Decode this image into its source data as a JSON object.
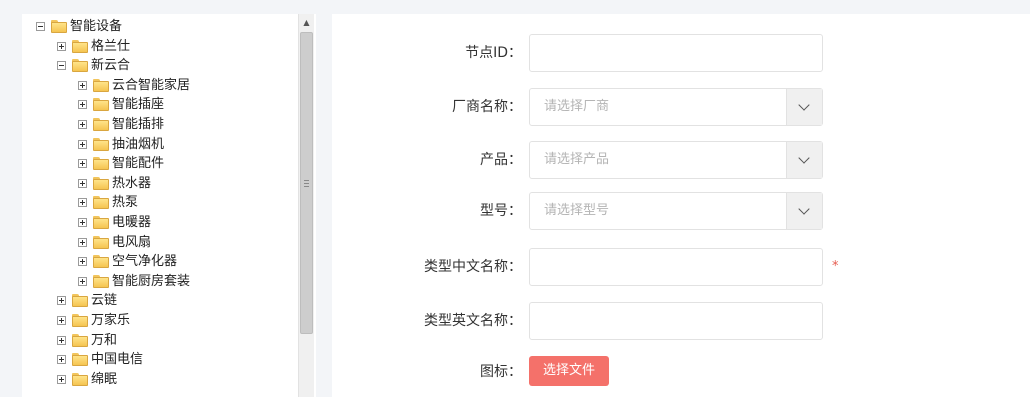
{
  "tree": {
    "nodes": [
      {
        "label": "智能设备",
        "expanded": true,
        "level": 0
      },
      {
        "label": "格兰仕",
        "expanded": false,
        "level": 1
      },
      {
        "label": "新云合",
        "expanded": true,
        "level": 1
      },
      {
        "label": "云合智能家居",
        "expanded": false,
        "level": 2
      },
      {
        "label": "智能插座",
        "expanded": false,
        "level": 2
      },
      {
        "label": "智能插排",
        "expanded": false,
        "level": 2
      },
      {
        "label": "抽油烟机",
        "expanded": false,
        "level": 2
      },
      {
        "label": "智能配件",
        "expanded": false,
        "level": 2
      },
      {
        "label": "热水器",
        "expanded": false,
        "level": 2
      },
      {
        "label": "热泵",
        "expanded": false,
        "level": 2
      },
      {
        "label": "电暖器",
        "expanded": false,
        "level": 2
      },
      {
        "label": "电风扇",
        "expanded": false,
        "level": 2
      },
      {
        "label": "空气净化器",
        "expanded": false,
        "level": 2
      },
      {
        "label": "智能厨房套装",
        "expanded": false,
        "level": 2
      },
      {
        "label": "云链",
        "expanded": false,
        "level": 1
      },
      {
        "label": "万家乐",
        "expanded": false,
        "level": 1
      },
      {
        "label": "万和",
        "expanded": false,
        "level": 1
      },
      {
        "label": "中国电信",
        "expanded": false,
        "level": 1
      },
      {
        "label": "绵眠",
        "expanded": false,
        "level": 1
      }
    ]
  },
  "form": {
    "node_id": {
      "label": "节点ID：",
      "value": ""
    },
    "vendor": {
      "label": "厂商名称：",
      "placeholder": "请选择厂商"
    },
    "product": {
      "label": "产品：",
      "placeholder": "请选择产品"
    },
    "model": {
      "label": "型号：",
      "placeholder": "请选择型号"
    },
    "type_cn": {
      "label": "类型中文名称：",
      "value": "",
      "required_mark": "*"
    },
    "type_en": {
      "label": "类型英文名称：",
      "value": ""
    },
    "icon": {
      "label": "图标：",
      "button": "选择文件"
    }
  },
  "colors": {
    "accent": "#f4716a",
    "required": "#e65c4f",
    "folder": "#f5c451"
  }
}
